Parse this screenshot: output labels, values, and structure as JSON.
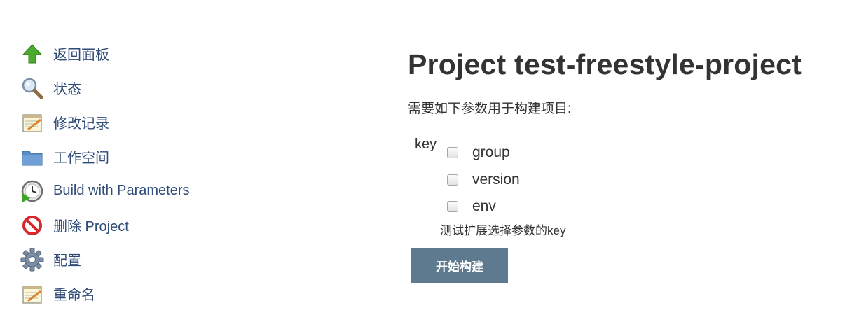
{
  "sidebar": {
    "items": [
      {
        "label": "返回面板",
        "icon": "up-arrow-icon"
      },
      {
        "label": "状态",
        "icon": "search-icon"
      },
      {
        "label": "修改记录",
        "icon": "notepad-icon"
      },
      {
        "label": "工作空间",
        "icon": "folder-icon"
      },
      {
        "label": "Build with Parameters",
        "icon": "clock-build-icon"
      },
      {
        "label": "删除 Project",
        "icon": "no-entry-icon"
      },
      {
        "label": "配置",
        "icon": "gear-icon"
      },
      {
        "label": "重命名",
        "icon": "notepad-icon"
      }
    ]
  },
  "main": {
    "title": "Project test-freestyle-project",
    "subtitle": "需要如下参数用于构建项目:",
    "parameter": {
      "name": "key",
      "options": [
        {
          "label": "group",
          "checked": false
        },
        {
          "label": "version",
          "checked": false
        },
        {
          "label": "env",
          "checked": false
        }
      ],
      "description": "测试扩展选择参数的key"
    },
    "build_button": "开始构建"
  },
  "colors": {
    "link": "#2f4b78",
    "button_bg": "#5d7a8e",
    "text": "#333333"
  }
}
